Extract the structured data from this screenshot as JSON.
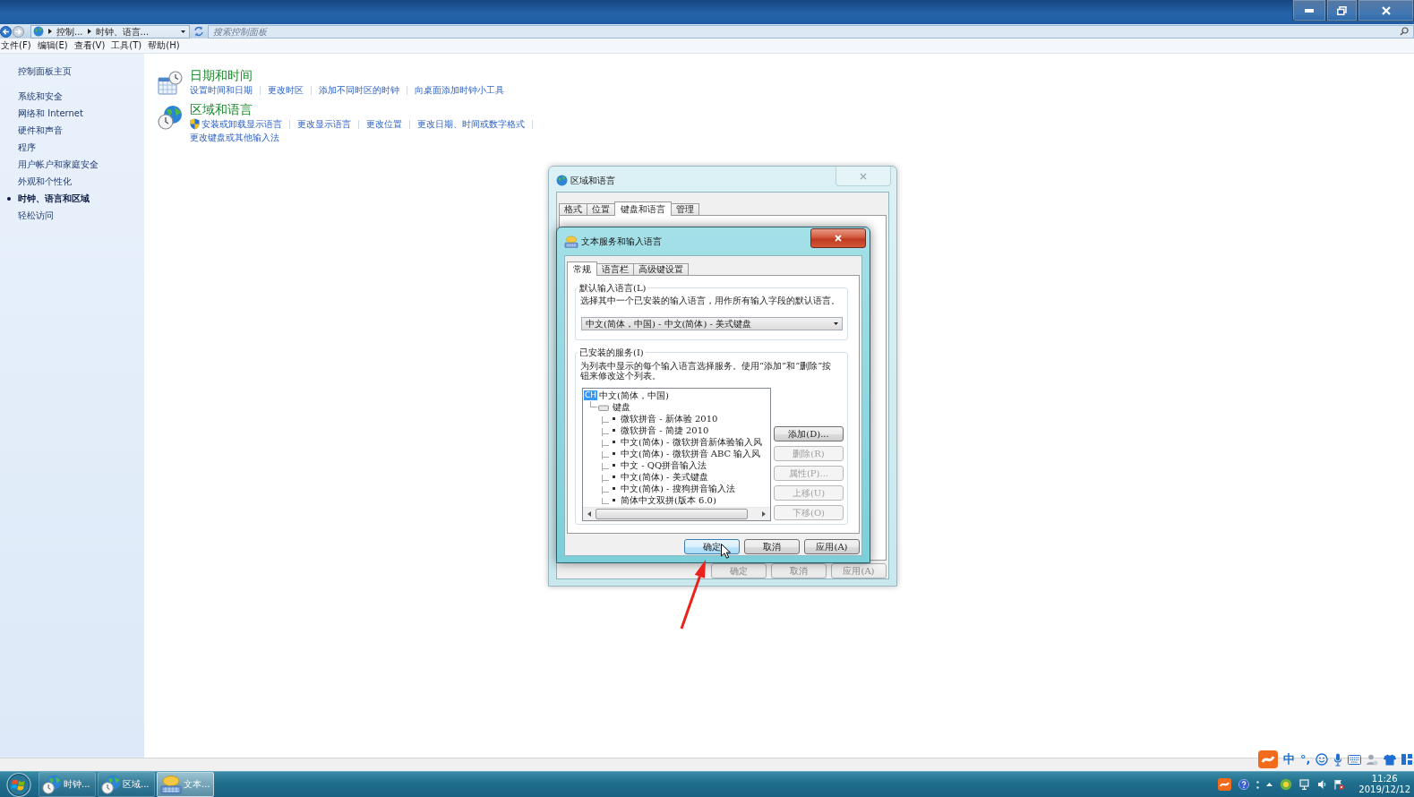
{
  "address_bar": {
    "breadcrumbs": [
      "控制...",
      "时钟、语言..."
    ]
  },
  "search": {
    "placeholder": "搜索控制面板"
  },
  "menu": [
    "文件(F)",
    "编辑(E)",
    "查看(V)",
    "工具(T)",
    "帮助(H)"
  ],
  "sidebar": {
    "home": "控制面板主页",
    "items": [
      {
        "label": "系统和安全",
        "selected": false
      },
      {
        "label": "网络和 Internet",
        "selected": false
      },
      {
        "label": "硬件和声音",
        "selected": false
      },
      {
        "label": "程序",
        "selected": false
      },
      {
        "label": "用户帐户和家庭安全",
        "selected": false
      },
      {
        "label": "外观和个性化",
        "selected": false
      },
      {
        "label": "时钟、语言和区域",
        "selected": true
      },
      {
        "label": "轻松访问",
        "selected": false
      }
    ]
  },
  "categories": [
    {
      "kind": "datetime",
      "title": "日期和时间",
      "links": [
        {
          "label": "设置时间和日期",
          "shield": false
        },
        {
          "label": "更改时区",
          "shield": false
        },
        {
          "label": "添加不同时区的时钟",
          "shield": false
        },
        {
          "label": "向桌面添加时钟小工具",
          "shield": false
        }
      ]
    },
    {
      "kind": "region",
      "title": "区域和语言",
      "links": [
        {
          "label": "安装或卸载显示语言",
          "shield": true
        },
        {
          "label": "更改显示语言",
          "shield": false
        },
        {
          "label": "更改位置",
          "shield": false
        },
        {
          "label": "更改日期、时间或数字格式",
          "shield": false
        },
        {
          "label": "更改键盘或其他输入法",
          "shield": false
        }
      ]
    }
  ],
  "region_dialog": {
    "title": "区域和语言",
    "tabs": [
      {
        "label": "格式",
        "selected": false
      },
      {
        "label": "位置",
        "selected": false
      },
      {
        "label": "键盘和语言",
        "selected": true
      },
      {
        "label": "管理",
        "selected": false
      }
    ],
    "buttons": [
      "确定",
      "取消",
      "应用(A)"
    ]
  },
  "text_services_dialog": {
    "title": "文本服务和输入语言",
    "tabs": [
      {
        "label": "常规",
        "selected": true
      },
      {
        "label": "语言栏",
        "selected": false
      },
      {
        "label": "高级键设置",
        "selected": false
      }
    ],
    "default_language": {
      "label": "默认输入语言(L)",
      "description": "选择其中一个已安装的输入语言，用作所有输入字段的默认语言。",
      "value": "中文(简体，中国) - 中文(简体) - 美式键盘"
    },
    "installed_services": {
      "label": "已安装的服务(I)",
      "description": "为列表中显示的每个输入语言选择服务。使用“添加”和“删除”按钮来修改这个列表。",
      "tree": [
        {
          "badge": "CH",
          "label": "中文(简体，中国)",
          "children": [
            {
              "label": "键盘",
              "children": [
                {
                  "label": "微软拼音 - 新体验 2010"
                },
                {
                  "label": "微软拼音 - 简捷 2010"
                },
                {
                  "label": "中文(简体) - 微软拼音新体验输入风"
                },
                {
                  "label": "中文(简体) - 微软拼音 ABC 输入风"
                },
                {
                  "label": "中文 - QQ拼音输入法"
                },
                {
                  "label": "中文(简体) - 美式键盘"
                },
                {
                  "label": "中文(简体) - 搜狗拼音输入法"
                },
                {
                  "label": "简体中文双拼(版本 6.0)"
                }
              ]
            }
          ]
        }
      ],
      "buttons": [
        {
          "label": "添加(D)...",
          "disabled": false
        },
        {
          "label": "删除(R)",
          "disabled": true
        },
        {
          "label": "属性(P)...",
          "disabled": true
        },
        {
          "label": "上移(U)",
          "disabled": true
        },
        {
          "label": "下移(O)",
          "disabled": true
        }
      ]
    },
    "buttons": [
      {
        "label": "确定",
        "focused": true
      },
      {
        "label": "取消",
        "focused": false
      },
      {
        "label": "应用(A)",
        "focused": false
      }
    ]
  },
  "taskbar": {
    "buttons": [
      {
        "kind": "globe-clock",
        "label": "时钟...",
        "selected": false
      },
      {
        "kind": "globe-clock",
        "label": "区域...",
        "selected": false
      },
      {
        "kind": "speech-keyboard",
        "label": "文本...",
        "selected": true
      }
    ],
    "clock": {
      "time": "11:26",
      "date": "2019/12/12"
    }
  },
  "ime_bar": {
    "mode": "中",
    "punctuation": "°,"
  }
}
